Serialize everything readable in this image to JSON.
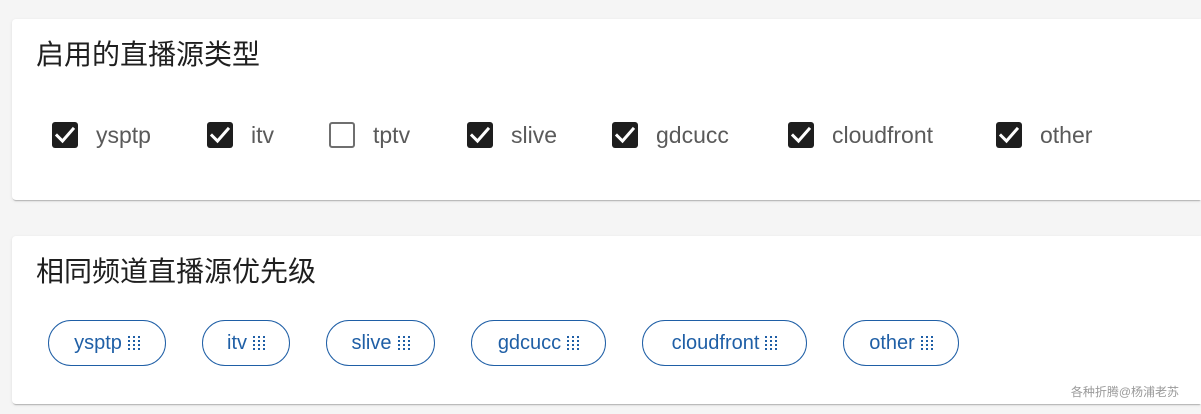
{
  "source_types_card": {
    "title": "启用的直播源类型",
    "options": [
      {
        "label": "ysptp",
        "checked": true
      },
      {
        "label": "itv",
        "checked": true
      },
      {
        "label": "tptv",
        "checked": false
      },
      {
        "label": "slive",
        "checked": true
      },
      {
        "label": "gdcucc",
        "checked": true
      },
      {
        "label": "cloudfront",
        "checked": true
      },
      {
        "label": "other",
        "checked": true
      }
    ]
  },
  "priority_card": {
    "title": "相同频道直播源优先级",
    "chips": [
      "ysptp",
      "itv",
      "slive",
      "gdcucc",
      "cloudfront",
      "other"
    ]
  },
  "watermark": "各种折腾@杨浦老苏",
  "colors": {
    "accent": "#1f5fa6",
    "checkbox_checked": "#1e1e1e",
    "checkbox_unchecked_border": "#6f6f6f",
    "label_text": "#5a5a5a"
  },
  "icons": {
    "checked": "check-icon",
    "drag_handle": "drag-handle-icon"
  }
}
